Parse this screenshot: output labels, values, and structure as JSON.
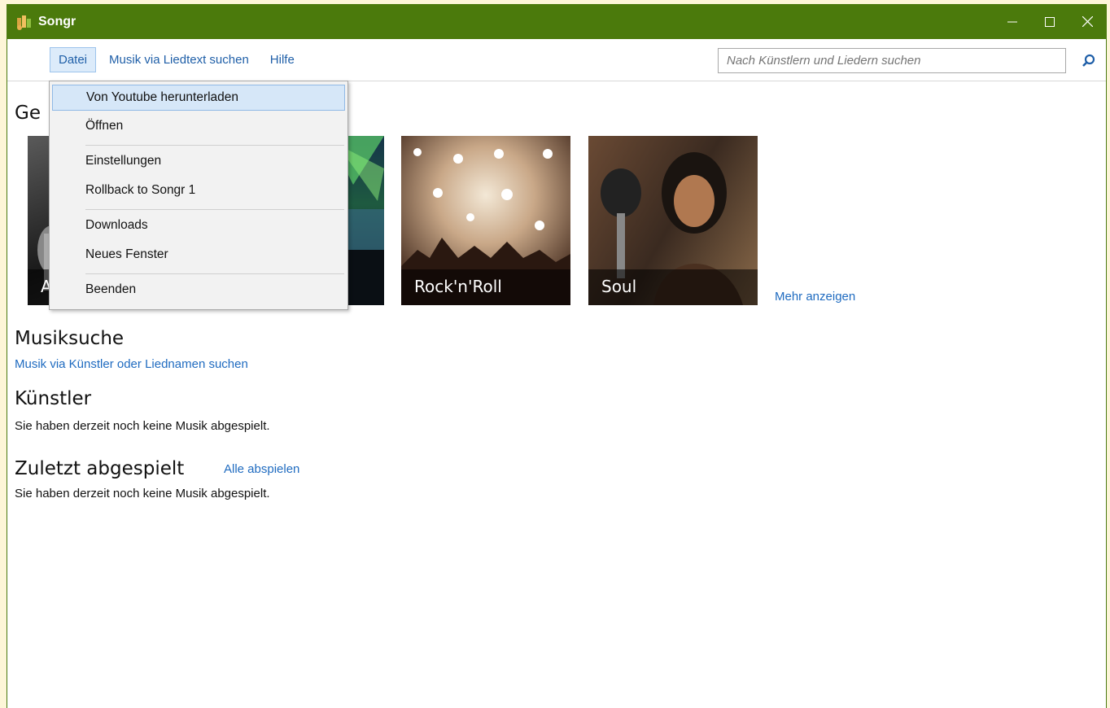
{
  "window": {
    "title": "Songr",
    "titlebar_color": "#4b7a0c"
  },
  "menubar": {
    "items": [
      {
        "label": "Datei"
      },
      {
        "label": "Musik via Liedtext suchen"
      },
      {
        "label": "Hilfe"
      }
    ]
  },
  "search": {
    "placeholder": "Nach Künstlern und Liedern suchen",
    "icon": "search-icon"
  },
  "dropdown": {
    "items": [
      {
        "label": "Von Youtube herunterladen"
      },
      {
        "label": "Öffnen"
      },
      {
        "label": "Einstellungen"
      },
      {
        "label": "Rollback to Songr 1"
      },
      {
        "label": "Downloads"
      },
      {
        "label": "Neues Fenster"
      },
      {
        "label": "Beenden"
      }
    ]
  },
  "genres": {
    "title_partial": "Ge",
    "tiles": [
      {
        "label": "A"
      },
      {
        "label": ""
      },
      {
        "label": "Rock'n'Roll"
      },
      {
        "label": "Soul"
      }
    ],
    "more_link": "Mehr anzeigen"
  },
  "musiksuche": {
    "title": "Musiksuche",
    "link": "Musik via Künstler oder Liednamen suchen"
  },
  "kuenstler": {
    "title": "Künstler",
    "text": "Sie haben derzeit noch keine Musik abgespielt."
  },
  "zuletzt": {
    "title": "Zuletzt abgespielt",
    "link": "Alle abspielen",
    "text": "Sie haben derzeit noch keine Musik abgespielt."
  }
}
